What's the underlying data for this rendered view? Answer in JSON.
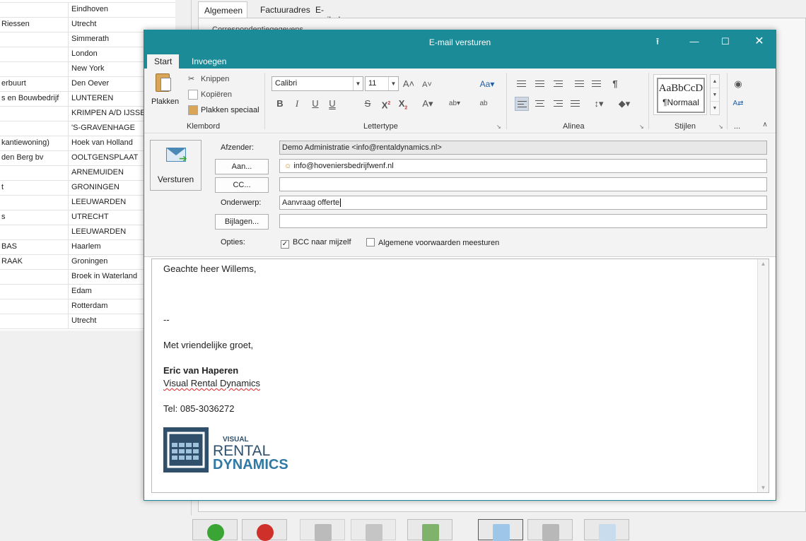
{
  "background": {
    "list_rows": [
      {
        "col1": "",
        "col2": "Eindhoven"
      },
      {
        "col1": "Riessen",
        "col2": "Utrecht"
      },
      {
        "col1": "",
        "col2": "Simmerath"
      },
      {
        "col1": "",
        "col2": "London"
      },
      {
        "col1": "",
        "col2": "New York"
      },
      {
        "col1": "erbuurt",
        "col2": "Den Oever"
      },
      {
        "col1": "s en Bouwbedrijf",
        "col2": "LUNTEREN"
      },
      {
        "col1": "",
        "col2": "KRIMPEN A/D IJSSEL"
      },
      {
        "col1": "",
        "col2": "'S-GRAVENHAGE"
      },
      {
        "col1": "kantiewoning)",
        "col2": "Hoek van Holland"
      },
      {
        "col1": "den Berg bv",
        "col2": "OOLTGENSPLAAT"
      },
      {
        "col1": "",
        "col2": "ARNEMUIDEN"
      },
      {
        "col1": "t",
        "col2": "GRONINGEN"
      },
      {
        "col1": "",
        "col2": "LEEUWARDEN"
      },
      {
        "col1": "s",
        "col2": "UTRECHT"
      },
      {
        "col1": "",
        "col2": "LEEUWARDEN"
      },
      {
        "col1": "BAS",
        "col2": "Haarlem"
      },
      {
        "col1": "RAAK",
        "col2": "Groningen"
      },
      {
        "col1": "",
        "col2": "Broek in Waterland"
      },
      {
        "col1": "",
        "col2": "Edam"
      },
      {
        "col1": "",
        "col2": "Rotterdam"
      },
      {
        "col1": "",
        "col2": "Utrecht"
      }
    ],
    "tabs": [
      "Algemeen",
      "Factuuradres",
      "E-mailadressen"
    ],
    "section_label": "Correspondentiegegevens"
  },
  "dialog": {
    "title": "E-mail versturen",
    "ribbon_tabs": [
      "Start",
      "Invoegen"
    ],
    "clipboard": {
      "paste": "Plakken",
      "cut": "Knippen",
      "copy": "Kopiëren",
      "paste_special": "Plakken speciaal",
      "group": "Klembord"
    },
    "font": {
      "family": "Calibri",
      "size": "11",
      "group": "Lettertype"
    },
    "paragraph": {
      "group": "Alinea"
    },
    "styles": {
      "preview": "AaBbCcD",
      "name": "¶Normaal",
      "group": "Stijlen"
    },
    "more": "...",
    "form": {
      "send": "Versturen",
      "from_label": "Afzender:",
      "from_value": "Demo Administratie <info@rentaldynamics.nl>",
      "to_button": "Aan...",
      "to_value": "info@hoveniersbedrijfwenf.nl",
      "cc_button": "CC...",
      "cc_value": "",
      "subject_label": "Onderwerp:",
      "subject_value": "Aanvraag offerte",
      "attach_button": "Bijlagen...",
      "attach_value": "",
      "options_label": "Opties:",
      "option_bcc": "BCC naar mijzelf",
      "option_bcc_checked": true,
      "option_terms": "Algemene voorwaarden meesturen",
      "option_terms_checked": false
    },
    "body": {
      "greeting": "Geachte heer Willems,",
      "separator": "--",
      "closing": "Met vriendelijke groet,",
      "name": "Eric van Haperen",
      "company": "Visual Rental Dynamics",
      "phone": "Tel:  085-3036272",
      "logo": {
        "line1": "VISUAL",
        "line2": "RENTAL",
        "line3": "DYNAMICS",
        "color_dark": "#2f4f6a",
        "color_accent": "#2f7aa5"
      }
    }
  }
}
